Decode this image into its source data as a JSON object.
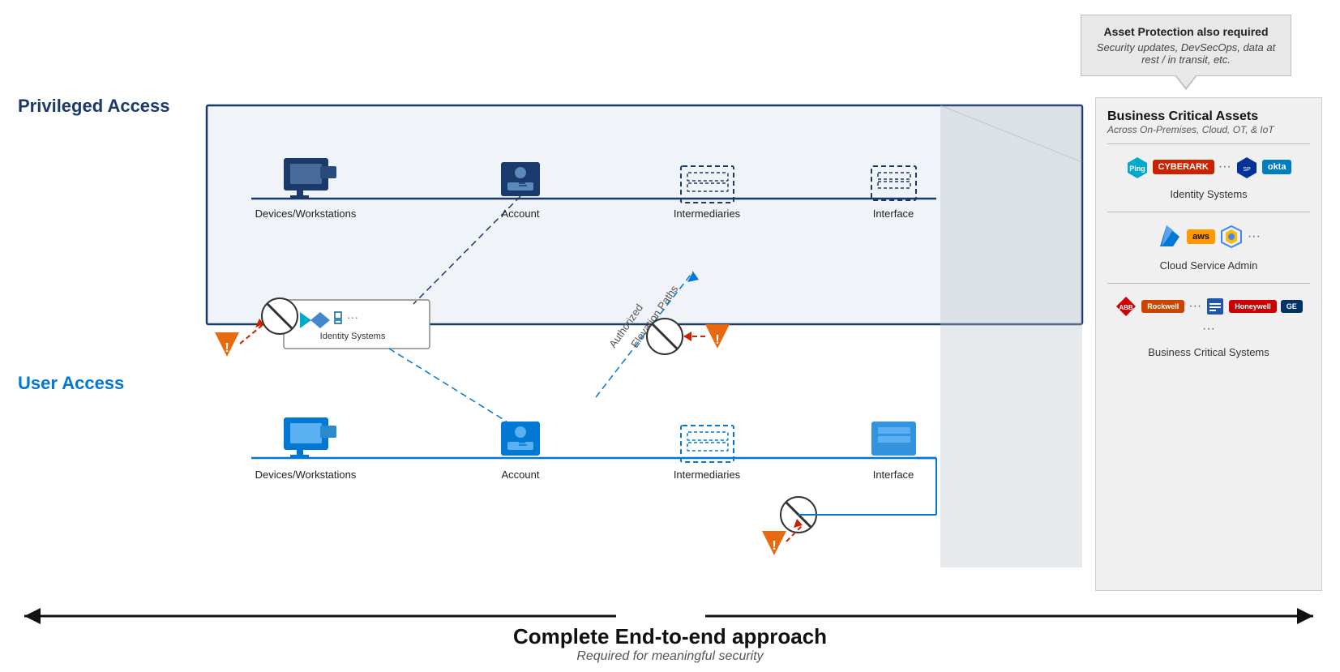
{
  "callout": {
    "title": "Asset Protection also required",
    "body": "Security updates, DevSecOps, data at rest / in transit, etc."
  },
  "labels": {
    "privileged_access": "Privileged Access",
    "user_access": "User Access",
    "devices_workstations": "Devices/Workstations",
    "account": "Account",
    "intermediaries": "Intermediaries",
    "interface": "Interface",
    "identity_systems": "Identity Systems",
    "authorized_elevation": "Authorized\nElevation Paths",
    "bottom_title": "Complete End-to-end approach",
    "bottom_sub": "Required for meaningful security"
  },
  "bca": {
    "title": "Business Critical Assets",
    "subtitle": "Across On-Premises, Cloud, OT, & IoT",
    "identity_systems_label": "Identity Systems",
    "cloud_admin_label": "Cloud Service Admin",
    "bcs_label": "Business Critical Systems",
    "identity_logos": [
      "Ping",
      "CyberArk",
      "SailPoint",
      "okta"
    ],
    "cloud_logos": [
      "Azure",
      "aws",
      "GCP"
    ],
    "bcs_logos": [
      "ABB",
      "Rockwell",
      "Honeywell",
      "GE"
    ]
  }
}
